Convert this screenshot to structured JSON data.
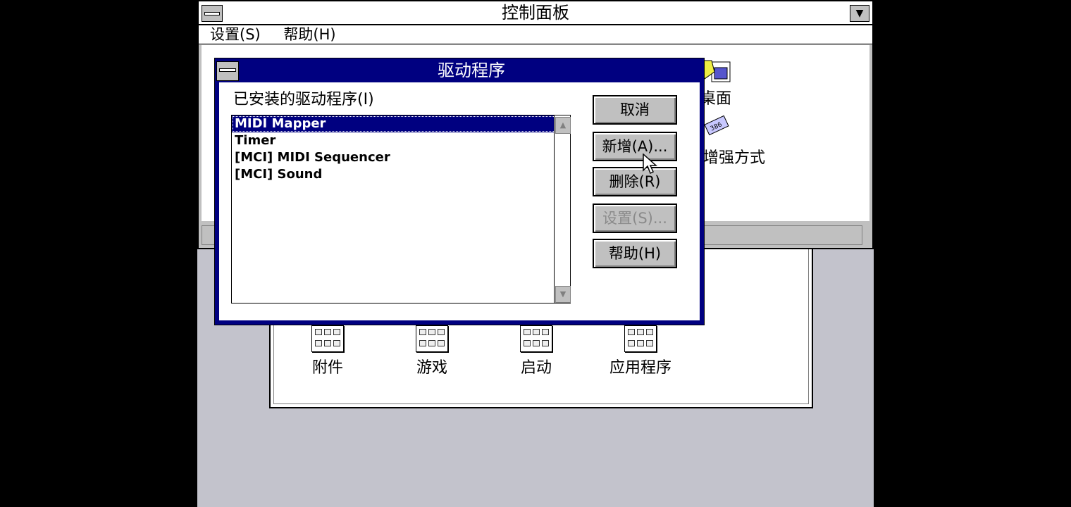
{
  "control_panel": {
    "title": "控制面板",
    "menu": [
      "设置(S)",
      "帮助(H)"
    ],
    "visible_items": [
      "桌面",
      "增强方式"
    ]
  },
  "group_window": {
    "icons": [
      "附件",
      "游戏",
      "启动",
      "应用程序"
    ]
  },
  "driver_dialog": {
    "title": "驱动程序",
    "list_label": "已安装的驱动程序(I)",
    "drivers": [
      "MIDI Mapper",
      "Timer",
      "[MCI] MIDI Sequencer",
      "[MCI] Sound"
    ],
    "selected_index": 0,
    "buttons": {
      "cancel": "取消",
      "add": "新增(A)...",
      "remove": "删除(R)",
      "setup": "设置(S)...",
      "help": "帮助(H)"
    }
  },
  "colors": {
    "title_active": "#000080",
    "desktop": "#c3c3cc",
    "selection": "#000080"
  },
  "icons": [
    "system-menu-icon",
    "minimize-arrow-icon",
    "desktop-icon",
    "386-chip-icon",
    "program-group-icon",
    "scroll-up-icon",
    "scroll-down-icon",
    "mouse-pointer-icon"
  ]
}
